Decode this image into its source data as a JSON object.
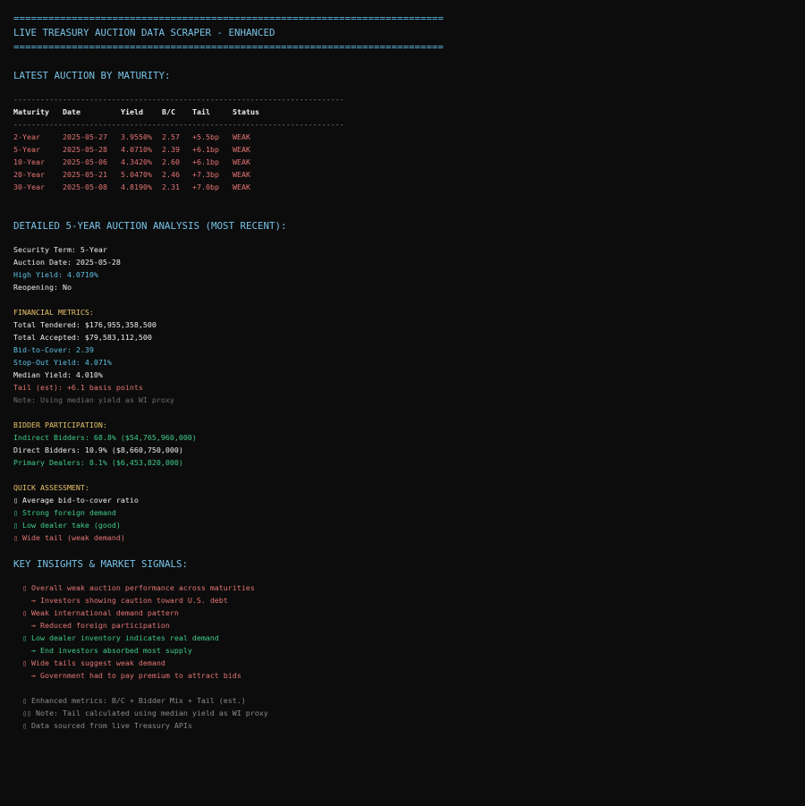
{
  "banner": {
    "rule": "==========================================================================",
    "title": "LIVE TREASURY AUCTION DATA SCRAPER - ENHANCED"
  },
  "latest": {
    "heading": "LATEST AUCTION BY MATURITY:",
    "dash_rule": "--------------------------------------------------------------------------",
    "columns": [
      "Maturity",
      "Date",
      "Yield",
      "B/C",
      "Tail",
      "Status"
    ],
    "rows": [
      [
        "2-Year",
        "2025-05-27",
        "3.9550%",
        "2.57",
        "+5.5bp",
        "WEAK"
      ],
      [
        "5-Year",
        "2025-05-28",
        "4.0710%",
        "2.39",
        "+6.1bp",
        "WEAK"
      ],
      [
        "10-Year",
        "2025-05-06",
        "4.3420%",
        "2.60",
        "+6.1bp",
        "WEAK"
      ],
      [
        "20-Year",
        "2025-05-21",
        "5.0470%",
        "2.46",
        "+7.3bp",
        "WEAK"
      ],
      [
        "30-Year",
        "2025-05-08",
        "4.8190%",
        "2.31",
        "+7.0bp",
        "WEAK"
      ]
    ]
  },
  "detail": {
    "heading": "DETAILED 5-YEAR AUCTION ANALYSIS (MOST RECENT):",
    "security_term": "Security Term: 5-Year",
    "auction_date": "Auction Date: 2025-05-28",
    "high_yield": "High Yield: 4.0710%",
    "reopening": "Reopening: No"
  },
  "financial": {
    "heading": "FINANCIAL METRICS:",
    "total_tendered": "Total Tendered: $176,955,358,500",
    "total_accepted": "Total Accepted: $79,583,112,500",
    "bid_to_cover": "Bid-to-Cover: 2.39",
    "stop_out": "Stop-Out Yield: 4.071%",
    "median_yield": "Median Yield: 4.010%",
    "tail": "Tail (est): +6.1 basis points",
    "note": "Note: Using median yield as WI proxy"
  },
  "bidders": {
    "heading": "BIDDER PARTICIPATION:",
    "indirect": "Indirect Bidders: 68.8% ($54,765,960,000)",
    "direct": "Direct Bidders: 10.9% ($8,660,750,000)",
    "primary": "Primary Dealers: 8.1% ($6,453,820,000)"
  },
  "quick": {
    "heading": "QUICK ASSESSMENT:",
    "items": [
      "Average bid-to-cover ratio",
      "Strong foreign demand",
      "Low dealer take (good)",
      "Wide tail (weak demand)"
    ]
  },
  "insights": {
    "heading": "KEY INSIGHTS & MARKET SIGNALS:",
    "items": [
      {
        "main": "Overall weak auction performance across maturities",
        "sub": "Investors showing caution toward U.S. debt"
      },
      {
        "main": "Weak international demand pattern",
        "sub": "Reduced foreign participation"
      },
      {
        "main": "Low dealer inventory indicates real demand",
        "sub": "End investors absorbed most supply"
      },
      {
        "main": "Wide tails suggest weak demand",
        "sub": "Government had to pay premium to attract bids"
      }
    ],
    "arrow": "→"
  },
  "footer": {
    "enhanced": "Enhanced metrics: B/C + Bidder Mix + Tail (est.)",
    "note": "Note: Tail calculated using median yield as WI proxy",
    "source": "Data sourced from live Treasury APIs"
  },
  "glyph": "▯",
  "glyph2": "▯▯",
  "colors": {
    "background": "#0c0c0c",
    "cyan": "#5eb6de",
    "red": "#e47474",
    "green": "#3fcc8a",
    "yellow": "#e8c36a",
    "gray": "#8a8a8a"
  }
}
